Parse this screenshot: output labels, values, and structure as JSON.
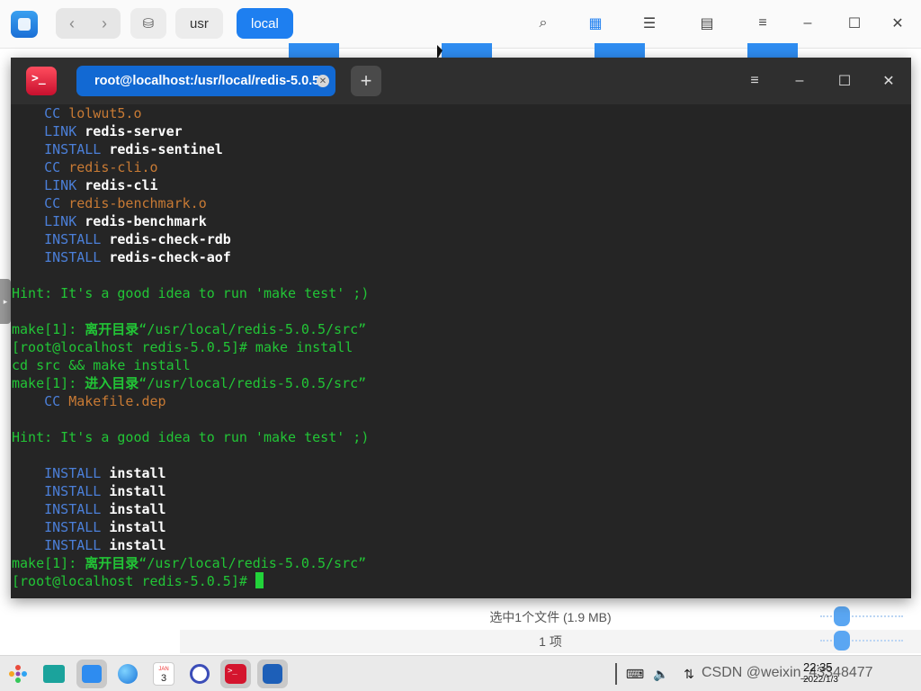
{
  "file_manager": {
    "breadcrumbs": [
      "usr",
      "local"
    ],
    "status_selected": "选中1个文件 (1.9 MB)",
    "status_count": "1 项"
  },
  "terminal": {
    "tab_title": "root@localhost:/usr/local/redis-5.0.5",
    "lines": [
      [
        [
          "kw",
          "    CC "
        ],
        [
          "or",
          "lolwut5.o"
        ]
      ],
      [
        [
          "kw",
          "    LINK "
        ],
        [
          "wt",
          "redis-server"
        ]
      ],
      [
        [
          "kw",
          "    INSTALL "
        ],
        [
          "wt",
          "redis-sentinel"
        ]
      ],
      [
        [
          "kw",
          "    CC "
        ],
        [
          "or",
          "redis-cli.o"
        ]
      ],
      [
        [
          "kw",
          "    LINK "
        ],
        [
          "wt",
          "redis-cli"
        ]
      ],
      [
        [
          "kw",
          "    CC "
        ],
        [
          "or",
          "redis-benchmark.o"
        ]
      ],
      [
        [
          "kw",
          "    LINK "
        ],
        [
          "wt",
          "redis-benchmark"
        ]
      ],
      [
        [
          "kw",
          "    INSTALL "
        ],
        [
          "wt",
          "redis-check-rdb"
        ]
      ],
      [
        [
          "kw",
          "    INSTALL "
        ],
        [
          "wt",
          "redis-check-aof"
        ]
      ],
      [],
      [
        [
          "gr",
          "Hint: It's a good idea to run 'make test' ;)"
        ]
      ],
      [],
      [
        [
          "gr",
          "make[1]: "
        ],
        [
          "gr-b",
          "离开目录"
        ],
        [
          "gr",
          "“/usr/local/redis-5.0.5/src”"
        ]
      ],
      [
        [
          "gr",
          "[root@localhost redis-5.0.5]# make install"
        ]
      ],
      [
        [
          "gr",
          "cd src && make install"
        ]
      ],
      [
        [
          "gr",
          "make[1]: "
        ],
        [
          "gr-b",
          "进入目录"
        ],
        [
          "gr",
          "“/usr/local/redis-5.0.5/src”"
        ]
      ],
      [
        [
          "kw",
          "    CC "
        ],
        [
          "or",
          "Makefile.dep"
        ]
      ],
      [],
      [
        [
          "gr",
          "Hint: It's a good idea to run 'make test' ;)"
        ]
      ],
      [],
      [
        [
          "kw",
          "    INSTALL "
        ],
        [
          "wt",
          "install"
        ]
      ],
      [
        [
          "kw",
          "    INSTALL "
        ],
        [
          "wt",
          "install"
        ]
      ],
      [
        [
          "kw",
          "    INSTALL "
        ],
        [
          "wt",
          "install"
        ]
      ],
      [
        [
          "kw",
          "    INSTALL "
        ],
        [
          "wt",
          "install"
        ]
      ],
      [
        [
          "kw",
          "    INSTALL "
        ],
        [
          "wt",
          "install"
        ]
      ],
      [
        [
          "gr",
          "make[1]: "
        ],
        [
          "gr-b",
          "离开目录"
        ],
        [
          "gr",
          "“/usr/local/redis-5.0.5/src”"
        ]
      ],
      [
        [
          "gr",
          "[root@localhost redis-5.0.5]# "
        ]
      ]
    ]
  },
  "taskbar": {
    "calendar_month": "JAN",
    "calendar_day": "3",
    "clock_time": "22:35",
    "clock_date": "2022/1/3",
    "watermark": "CSDN @weixin_43348477"
  }
}
